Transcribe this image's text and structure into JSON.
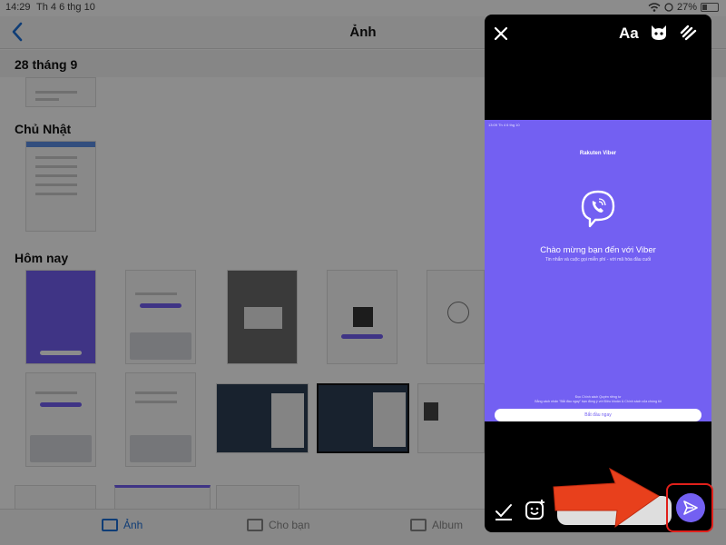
{
  "status_bar": {
    "time": "14:29",
    "date": "Th 4 6 thg 10",
    "battery": "27%"
  },
  "photos": {
    "title": "Ảnh",
    "sticky_header": "28 tháng 9",
    "sections": [
      "Chủ Nhật",
      "Hôm nay"
    ],
    "tabs": [
      {
        "label": "Ảnh",
        "active": true
      },
      {
        "label": "Cho bạn",
        "active": false
      },
      {
        "label": "Album",
        "active": false
      }
    ]
  },
  "editor": {
    "text_tool": "Aa",
    "preview": {
      "status_time": "13:09  Th 4 6 thg 10",
      "brand": "Rakuten Viber",
      "welcome": "Chào mừng bạn đến với Viber",
      "subtitle": "Tin nhắn và cuộc gọi miễn phí - với mã hóa đầu cuối",
      "legal_1": "Đọc Chính sách Quyền riêng tư",
      "legal_2": "Bằng cách nhấn \"Bắt đầu ngay\" bạn đồng ý với Điều khoản & Chính sách của chúng tôi",
      "start_button": "Bắt đầu ngay"
    }
  },
  "colors": {
    "viber_purple": "#7360f2",
    "accent_blue": "#1d6fd8",
    "arrow_red": "#e0201b"
  },
  "icons": [
    "chevron-left-icon",
    "close-icon",
    "mask-icon",
    "draw-icon",
    "check-icon",
    "sticker-icon",
    "send-icon"
  ]
}
